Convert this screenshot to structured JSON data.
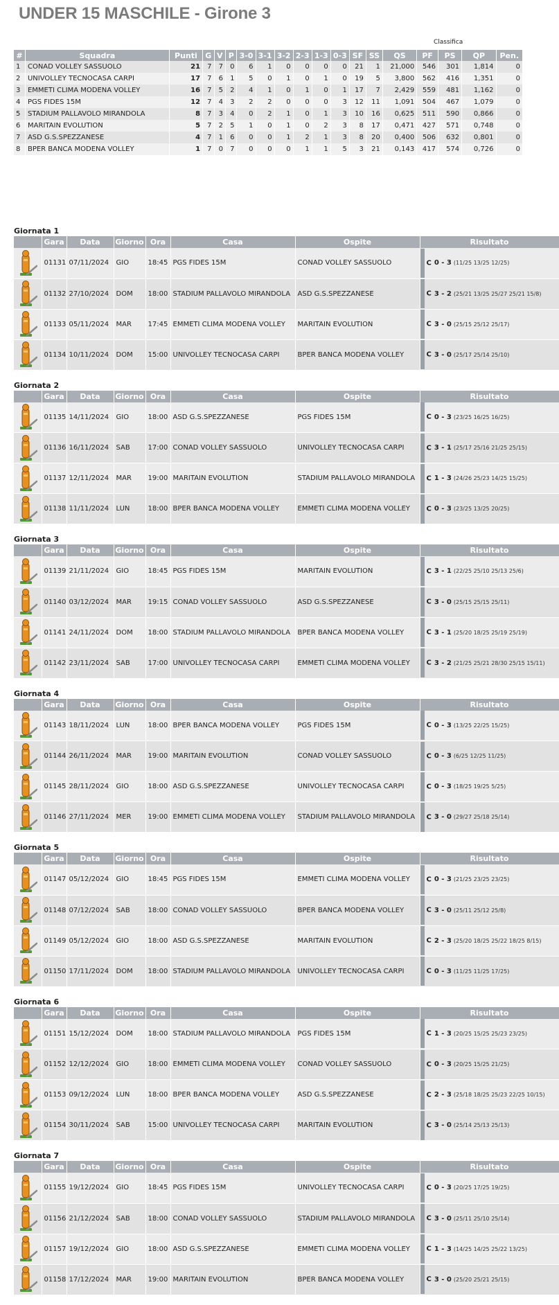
{
  "title": "UNDER 15 MASCHILE - Girone 3",
  "standings": {
    "caption": "Classifica",
    "headers": [
      "#",
      "Squadra",
      "Punti",
      "G",
      "V",
      "P",
      "3-0",
      "3-1",
      "3-2",
      "2-3",
      "1-3",
      "0-3",
      "SF",
      "SS",
      "QS",
      "PF",
      "PS",
      "QP",
      "Pen."
    ],
    "rows": [
      [
        "1",
        "CONAD VOLLEY SASSUOLO",
        "21",
        "7",
        "7",
        "0",
        "6",
        "1",
        "0",
        "0",
        "0",
        "0",
        "21",
        "1",
        "21,000",
        "546",
        "301",
        "1,814",
        "0"
      ],
      [
        "2",
        "UNIVOLLEY TECNOCASA CARPI",
        "17",
        "7",
        "6",
        "1",
        "5",
        "0",
        "1",
        "0",
        "1",
        "0",
        "19",
        "5",
        "3,800",
        "562",
        "416",
        "1,351",
        "0"
      ],
      [
        "3",
        "EMMETI CLIMA MODENA VOLLEY",
        "16",
        "7",
        "5",
        "2",
        "4",
        "1",
        "0",
        "1",
        "0",
        "1",
        "17",
        "7",
        "2,429",
        "559",
        "481",
        "1,162",
        "0"
      ],
      [
        "4",
        "PGS FIDES 15M",
        "12",
        "7",
        "4",
        "3",
        "2",
        "2",
        "0",
        "0",
        "0",
        "3",
        "12",
        "11",
        "1,091",
        "504",
        "467",
        "1,079",
        "0"
      ],
      [
        "5",
        "STADIUM PALLAVOLO MIRANDOLA",
        "8",
        "7",
        "3",
        "4",
        "0",
        "2",
        "1",
        "0",
        "1",
        "3",
        "10",
        "16",
        "0,625",
        "511",
        "590",
        "0,866",
        "0"
      ],
      [
        "6",
        "MARITAIN EVOLUTION",
        "5",
        "7",
        "2",
        "5",
        "1",
        "0",
        "1",
        "0",
        "2",
        "3",
        "8",
        "17",
        "0,471",
        "427",
        "571",
        "0,748",
        "0"
      ],
      [
        "7",
        "ASD G.S.SPEZZANESE",
        "4",
        "7",
        "1",
        "6",
        "0",
        "0",
        "1",
        "2",
        "1",
        "3",
        "8",
        "20",
        "0,400",
        "506",
        "632",
        "0,801",
        "0"
      ],
      [
        "8",
        "BPER BANCA MODENA VOLLEY",
        "1",
        "7",
        "0",
        "7",
        "0",
        "0",
        "0",
        "1",
        "1",
        "5",
        "3",
        "21",
        "0,143",
        "417",
        "574",
        "0,726",
        "0"
      ]
    ]
  },
  "match_headers": [
    "",
    "Gara",
    "Data",
    "Giorno",
    "Ora",
    "Casa",
    "Ospite",
    "Risultato"
  ],
  "rounds": [
    {
      "title": "Giornata 1",
      "matches": [
        {
          "gara": "01131",
          "data": "07/11/2024",
          "giorno": "GIO",
          "ora": "18:45",
          "casa": "PGS FIDES 15M",
          "ospite": "CONAD VOLLEY SASSUOLO",
          "c": "C",
          "score": "0 - 3",
          "sets": "(11/25 13/25 12/25)"
        },
        {
          "gara": "01132",
          "data": "27/10/2024",
          "giorno": "DOM",
          "ora": "18:00",
          "casa": "STADIUM PALLAVOLO MIRANDOLA",
          "ospite": "ASD G.S.SPEZZANESE",
          "c": "C",
          "score": "3 - 2",
          "sets": "(25/21 13/25 25/27 25/21 15/8)"
        },
        {
          "gara": "01133",
          "data": "05/11/2024",
          "giorno": "MAR",
          "ora": "17:45",
          "casa": "EMMETI CLIMA MODENA VOLLEY",
          "ospite": "MARITAIN EVOLUTION",
          "c": "C",
          "score": "3 - 0",
          "sets": "(25/15 25/12 25/17)"
        },
        {
          "gara": "01134",
          "data": "10/11/2024",
          "giorno": "DOM",
          "ora": "15:00",
          "casa": "UNIVOLLEY TECNOCASA CARPI",
          "ospite": "BPER BANCA MODENA VOLLEY",
          "c": "C",
          "score": "3 - 0",
          "sets": "(25/17 25/14 25/10)"
        }
      ]
    },
    {
      "title": "Giornata 2",
      "matches": [
        {
          "gara": "01135",
          "data": "14/11/2024",
          "giorno": "GIO",
          "ora": "18:00",
          "casa": "ASD G.S.SPEZZANESE",
          "ospite": "PGS FIDES 15M",
          "c": "C",
          "score": "0 - 3",
          "sets": "(23/25 16/25 16/25)"
        },
        {
          "gara": "01136",
          "data": "16/11/2024",
          "giorno": "SAB",
          "ora": "17:00",
          "casa": "CONAD VOLLEY SASSUOLO",
          "ospite": "UNIVOLLEY TECNOCASA CARPI",
          "c": "C",
          "score": "3 - 1",
          "sets": "(25/17 25/16 21/25 25/15)"
        },
        {
          "gara": "01137",
          "data": "12/11/2024",
          "giorno": "MAR",
          "ora": "19:00",
          "casa": "MARITAIN EVOLUTION",
          "ospite": "STADIUM PALLAVOLO MIRANDOLA",
          "c": "C",
          "score": "1 - 3",
          "sets": "(24/26 25/23 14/25 15/25)"
        },
        {
          "gara": "01138",
          "data": "11/11/2024",
          "giorno": "LUN",
          "ora": "18:00",
          "casa": "BPER BANCA MODENA VOLLEY",
          "ospite": "EMMETI CLIMA MODENA VOLLEY",
          "c": "C",
          "score": "0 - 3",
          "sets": "(23/25 13/25 20/25)"
        }
      ]
    },
    {
      "title": "Giornata 3",
      "matches": [
        {
          "gara": "01139",
          "data": "21/11/2024",
          "giorno": "GIO",
          "ora": "18:45",
          "casa": "PGS FIDES 15M",
          "ospite": "MARITAIN EVOLUTION",
          "c": "C",
          "score": "3 - 1",
          "sets": "(22/25 25/10 25/13 25/6)"
        },
        {
          "gara": "01140",
          "data": "03/12/2024",
          "giorno": "MAR",
          "ora": "19:15",
          "casa": "CONAD VOLLEY SASSUOLO",
          "ospite": "ASD G.S.SPEZZANESE",
          "c": "C",
          "score": "3 - 0",
          "sets": "(25/15 25/15 25/11)"
        },
        {
          "gara": "01141",
          "data": "24/11/2024",
          "giorno": "DOM",
          "ora": "18:00",
          "casa": "STADIUM PALLAVOLO MIRANDOLA",
          "ospite": "BPER BANCA MODENA VOLLEY",
          "c": "C",
          "score": "3 - 1",
          "sets": "(25/20 18/25 25/19 25/19)"
        },
        {
          "gara": "01142",
          "data": "23/11/2024",
          "giorno": "SAB",
          "ora": "17:00",
          "casa": "UNIVOLLEY TECNOCASA CARPI",
          "ospite": "EMMETI CLIMA MODENA VOLLEY",
          "c": "C",
          "score": "3 - 2",
          "sets": "(21/25 25/21 28/30 25/15 15/11)"
        }
      ]
    },
    {
      "title": "Giornata 4",
      "matches": [
        {
          "gara": "01143",
          "data": "18/11/2024",
          "giorno": "LUN",
          "ora": "18:00",
          "casa": "BPER BANCA MODENA VOLLEY",
          "ospite": "PGS FIDES 15M",
          "c": "C",
          "score": "0 - 3",
          "sets": "(13/25 22/25 15/25)"
        },
        {
          "gara": "01144",
          "data": "26/11/2024",
          "giorno": "MAR",
          "ora": "19:00",
          "casa": "MARITAIN EVOLUTION",
          "ospite": "CONAD VOLLEY SASSUOLO",
          "c": "C",
          "score": "0 - 3",
          "sets": "(6/25 12/25 11/25)"
        },
        {
          "gara": "01145",
          "data": "28/11/2024",
          "giorno": "GIO",
          "ora": "18:00",
          "casa": "ASD G.S.SPEZZANESE",
          "ospite": "UNIVOLLEY TECNOCASA CARPI",
          "c": "C",
          "score": "0 - 3",
          "sets": "(18/25 19/25 5/25)"
        },
        {
          "gara": "01146",
          "data": "27/11/2024",
          "giorno": "MER",
          "ora": "19:00",
          "casa": "EMMETI CLIMA MODENA VOLLEY",
          "ospite": "STADIUM PALLAVOLO MIRANDOLA",
          "c": "C",
          "score": "3 - 0",
          "sets": "(29/27 25/18 25/14)"
        }
      ]
    },
    {
      "title": "Giornata 5",
      "matches": [
        {
          "gara": "01147",
          "data": "05/12/2024",
          "giorno": "GIO",
          "ora": "18:45",
          "casa": "PGS FIDES 15M",
          "ospite": "EMMETI CLIMA MODENA VOLLEY",
          "c": "C",
          "score": "0 - 3",
          "sets": "(21/25 23/25 23/25)"
        },
        {
          "gara": "01148",
          "data": "07/12/2024",
          "giorno": "SAB",
          "ora": "18:00",
          "casa": "CONAD VOLLEY SASSUOLO",
          "ospite": "BPER BANCA MODENA VOLLEY",
          "c": "C",
          "score": "3 - 0",
          "sets": "(25/11 25/12 25/8)"
        },
        {
          "gara": "01149",
          "data": "05/12/2024",
          "giorno": "GIO",
          "ora": "18:00",
          "casa": "ASD G.S.SPEZZANESE",
          "ospite": "MARITAIN EVOLUTION",
          "c": "C",
          "score": "2 - 3",
          "sets": "(25/20 18/25 25/22 18/25 8/15)"
        },
        {
          "gara": "01150",
          "data": "17/11/2024",
          "giorno": "DOM",
          "ora": "18:00",
          "casa": "STADIUM PALLAVOLO MIRANDOLA",
          "ospite": "UNIVOLLEY TECNOCASA CARPI",
          "c": "C",
          "score": "0 - 3",
          "sets": "(11/25 11/25 17/25)"
        }
      ]
    },
    {
      "title": "Giornata 6",
      "matches": [
        {
          "gara": "01151",
          "data": "15/12/2024",
          "giorno": "DOM",
          "ora": "18:00",
          "casa": "STADIUM PALLAVOLO MIRANDOLA",
          "ospite": "PGS FIDES 15M",
          "c": "C",
          "score": "1 - 3",
          "sets": "(20/25 15/25 25/23 23/25)"
        },
        {
          "gara": "01152",
          "data": "12/12/2024",
          "giorno": "GIO",
          "ora": "18:00",
          "casa": "EMMETI CLIMA MODENA VOLLEY",
          "ospite": "CONAD VOLLEY SASSUOLO",
          "c": "C",
          "score": "0 - 3",
          "sets": "(20/25 15/25 21/25)"
        },
        {
          "gara": "01153",
          "data": "09/12/2024",
          "giorno": "LUN",
          "ora": "18:00",
          "casa": "BPER BANCA MODENA VOLLEY",
          "ospite": "ASD G.S.SPEZZANESE",
          "c": "C",
          "score": "2 - 3",
          "sets": "(25/18 18/25 25/23 22/25 10/15)"
        },
        {
          "gara": "01154",
          "data": "30/11/2024",
          "giorno": "SAB",
          "ora": "15:00",
          "casa": "UNIVOLLEY TECNOCASA CARPI",
          "ospite": "MARITAIN EVOLUTION",
          "c": "C",
          "score": "3 - 0",
          "sets": "(25/14 25/13 25/13)"
        }
      ]
    },
    {
      "title": "Giornata 7",
      "matches": [
        {
          "gara": "01155",
          "data": "19/12/2024",
          "giorno": "GIO",
          "ora": "18:45",
          "casa": "PGS FIDES 15M",
          "ospite": "UNIVOLLEY TECNOCASA CARPI",
          "c": "C",
          "score": "0 - 3",
          "sets": "(20/25 17/25 19/25)"
        },
        {
          "gara": "01156",
          "data": "21/12/2024",
          "giorno": "SAB",
          "ora": "18:00",
          "casa": "CONAD VOLLEY SASSUOLO",
          "ospite": "STADIUM PALLAVOLO MIRANDOLA",
          "c": "C",
          "score": "3 - 0",
          "sets": "(25/11 25/10 25/14)"
        },
        {
          "gara": "01157",
          "data": "19/12/2024",
          "giorno": "GIO",
          "ora": "18:00",
          "casa": "ASD G.S.SPEZZANESE",
          "ospite": "EMMETI CLIMA MODENA VOLLEY",
          "c": "C",
          "score": "1 - 3",
          "sets": "(14/25 14/25 25/22 13/25)"
        },
        {
          "gara": "01158",
          "data": "17/12/2024",
          "giorno": "MAR",
          "ora": "19:00",
          "casa": "MARITAIN EVOLUTION",
          "ospite": "BPER BANCA MODENA VOLLEY",
          "c": "C",
          "score": "3 - 0",
          "sets": "(25/20 25/21 25/15)"
        }
      ]
    }
  ],
  "icons": {
    "match_icon": "referee-whistle-icon"
  },
  "colors": {
    "header_bg": "#a9adb4",
    "row_a": "#ececec",
    "row_b": "#e2e2e2",
    "title": "#7b7b7b",
    "icon_orange": "#e8901e",
    "icon_green": "#4f9a2c"
  }
}
